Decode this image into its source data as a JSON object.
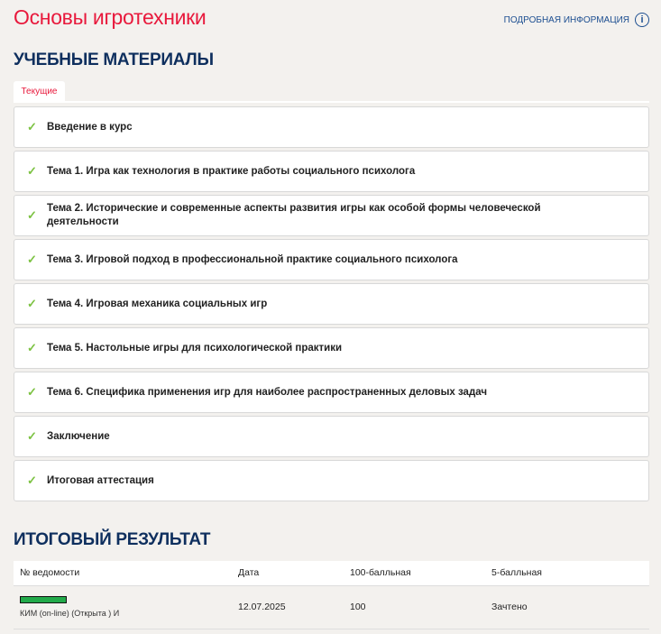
{
  "header": {
    "title": "Основы игротехники",
    "info_link": "ПОДРОБНАЯ ИНФОРМАЦИЯ",
    "info_icon": "info-icon"
  },
  "materials": {
    "heading": "УЧЕБНЫЕ МАТЕРИАЛЫ",
    "tab": "Текущие",
    "items": [
      {
        "label": "Введение в курс"
      },
      {
        "label": "Тема 1. Игра как технология в практике работы социального психолога"
      },
      {
        "label": "Тема 2. Исторические и современные аспекты развития игры как особой формы человеческой деятельности"
      },
      {
        "label": "Тема 3. Игровой подход в профессиональной практике социального психолога"
      },
      {
        "label": "Тема 4. Игровая механика социальных игр"
      },
      {
        "label": "Тема 5. Настольные игры для психологической практики"
      },
      {
        "label": "Тема 6. Специфика применения игр для наиболее распространенных деловых задач"
      },
      {
        "label": "Заключение"
      },
      {
        "label": "Итоговая аттестация"
      }
    ]
  },
  "result": {
    "heading": "ИТОГОВЫЙ РЕЗУЛЬТАТ",
    "columns": [
      "№ ведомости",
      "Дата",
      "100-балльная",
      "5-балльная"
    ],
    "rows": [
      {
        "statement": "КИМ (on-line) (Открыта ) И",
        "date": "12.07.2025",
        "score100": "100",
        "score5": "Зачтено",
        "bar_color": "#22aa4a"
      }
    ]
  }
}
